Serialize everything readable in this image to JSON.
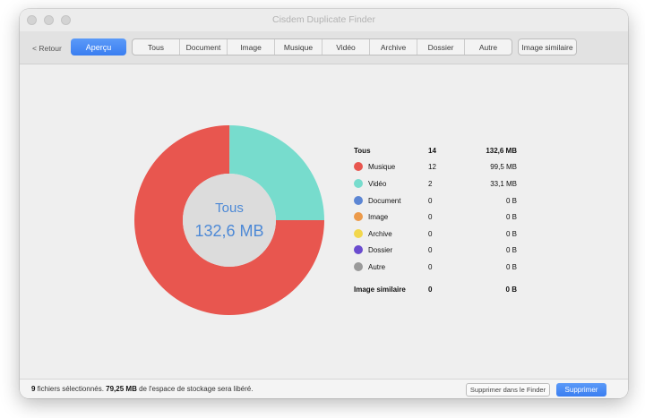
{
  "window": {
    "title": "Cisdem Duplicate Finder"
  },
  "toolbar": {
    "back_label": "< Retour",
    "apercu_label": "Aperçu",
    "tabs": [
      {
        "label": "Tous"
      },
      {
        "label": "Document"
      },
      {
        "label": "Image"
      },
      {
        "label": "Musique"
      },
      {
        "label": "Vidéo"
      },
      {
        "label": "Archive"
      },
      {
        "label": "Dossier"
      },
      {
        "label": "Autre"
      }
    ],
    "similar_label": "Image similaire"
  },
  "donut": {
    "center_title": "Tous",
    "center_value": "132,6 MB"
  },
  "stats": {
    "header": {
      "name": "Tous",
      "count": "14",
      "size": "132,6 MB"
    },
    "rows": [
      {
        "name": "Musique",
        "count": "12",
        "size": "99,5 MB",
        "color": "#e8564f",
        "icon": "music-dot"
      },
      {
        "name": "Vidéo",
        "count": "2",
        "size": "33,1 MB",
        "color": "#77dccd",
        "icon": "video-dot"
      },
      {
        "name": "Document",
        "count": "0",
        "size": "0 B",
        "color": "#5c86d4",
        "icon": "document-dot"
      },
      {
        "name": "Image",
        "count": "0",
        "size": "0 B",
        "color": "#ec9a4a",
        "icon": "image-dot"
      },
      {
        "name": "Archive",
        "count": "0",
        "size": "0 B",
        "color": "#f2d74c",
        "icon": "archive-dot"
      },
      {
        "name": "Dossier",
        "count": "0",
        "size": "0 B",
        "color": "#6b4ccf",
        "icon": "folder-dot"
      },
      {
        "name": "Autre",
        "count": "0",
        "size": "0 B",
        "color": "#9a9a9a",
        "icon": "other-dot"
      }
    ],
    "similar": {
      "name": "Image similaire",
      "count": "0",
      "size": "0 B"
    }
  },
  "chart_data": {
    "type": "pie",
    "categories": [
      "Musique",
      "Vidéo",
      "Document",
      "Image",
      "Archive",
      "Dossier",
      "Autre"
    ],
    "values": [
      99.5,
      33.1,
      0,
      0,
      0,
      0,
      0
    ],
    "unit": "MB",
    "colors": [
      "#e8564f",
      "#77dccd",
      "#5c86d4",
      "#ec9a4a",
      "#f2d74c",
      "#6b4ccf",
      "#9a9a9a"
    ]
  },
  "statusbar": {
    "count": "9",
    "text1": " fichiers sélectionnés. ",
    "size": "79,25 MB",
    "text2": " de l'espace de stockage sera libéré.",
    "finder_button": "Supprimer dans le Finder",
    "delete_button": "Supprimer"
  }
}
